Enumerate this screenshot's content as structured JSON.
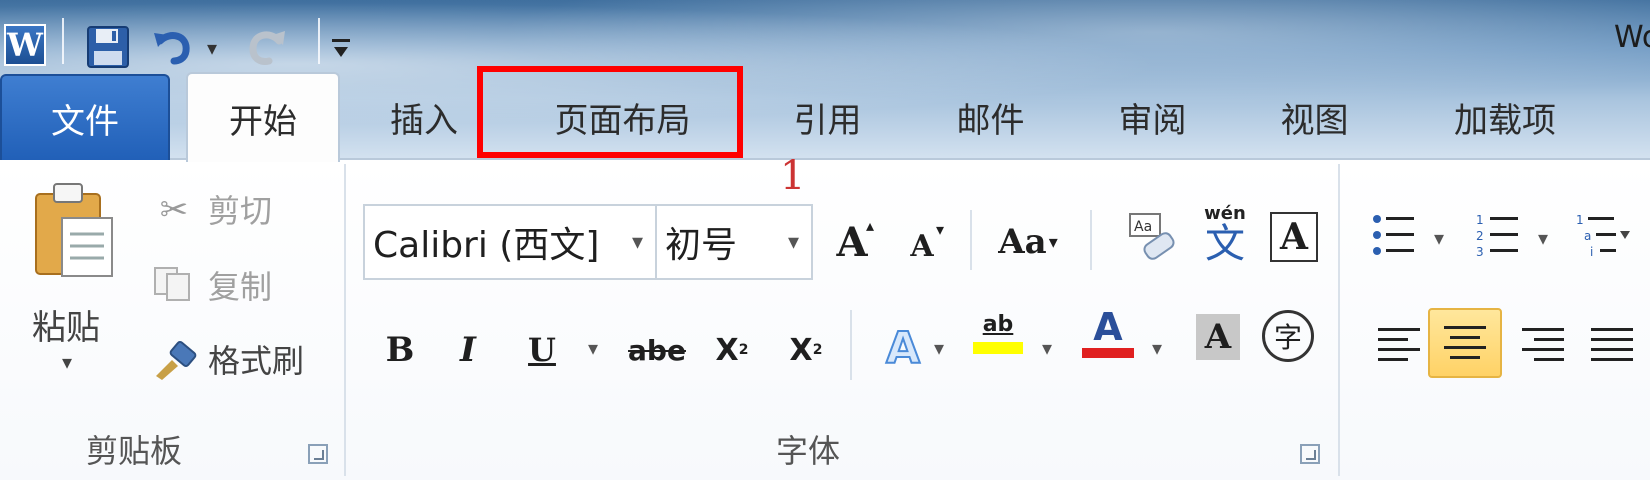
{
  "title_bar": {
    "window_title": "Wo",
    "logo_letter": "W"
  },
  "quick_access": {
    "icons": [
      "word-logo",
      "save-icon",
      "undo-icon",
      "undo-dropdown",
      "redo-icon",
      "customize-qat-icon"
    ]
  },
  "tabs": [
    {
      "label": "文件",
      "active": false,
      "style": "file"
    },
    {
      "label": "开始",
      "active": true
    },
    {
      "label": "插入",
      "active": false
    },
    {
      "label": "页面布局",
      "active": false,
      "highlighted": true
    },
    {
      "label": "引用",
      "active": false
    },
    {
      "label": "邮件",
      "active": false
    },
    {
      "label": "审阅",
      "active": false
    },
    {
      "label": "视图",
      "active": false
    },
    {
      "label": "加载项",
      "active": false
    }
  ],
  "annotation": {
    "number": "1",
    "color": "#ff0000"
  },
  "clipboard": {
    "paste_label": "粘贴",
    "cut_label": "剪切",
    "copy_label": "复制",
    "format_painter_label": "格式刷",
    "group_label": "剪贴板"
  },
  "font": {
    "font_name": "Calibri (西文]",
    "font_size": "初号",
    "grow_label": "A",
    "shrink_label": "A",
    "change_case_label": "Aa",
    "phonetic_label": "wén",
    "phonetic_char": "文",
    "border_char": "A",
    "bold_label": "B",
    "italic_label": "I",
    "underline_label": "U",
    "strike_label": "abe",
    "subscript_label": "X",
    "subscript_mark": "2",
    "superscript_label": "X",
    "superscript_mark": "2",
    "effects_label": "A",
    "highlight_label": "ab",
    "font_color_label": "A",
    "shading_label": "A",
    "enclose_char": "字",
    "group_label": "字体",
    "highlight_color": "#ffff00",
    "font_color": "#e02020"
  },
  "paragraph": {
    "active_alignment": "center"
  }
}
